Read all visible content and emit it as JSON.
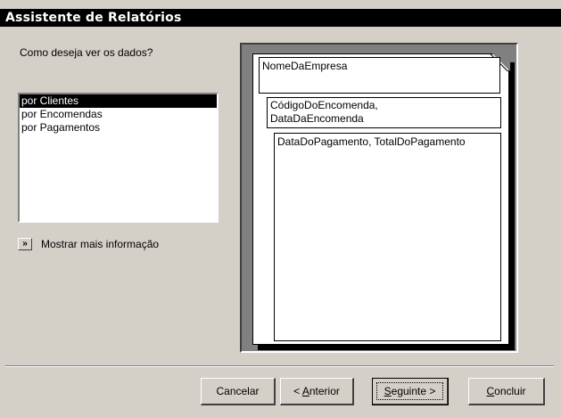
{
  "window": {
    "title": "Assistente de Relatórios"
  },
  "question": "Como deseja ver os dados?",
  "view_list": {
    "items": [
      {
        "label": "por Clientes",
        "selected": true
      },
      {
        "label": "por Encomendas",
        "selected": false
      },
      {
        "label": "por Pagamentos",
        "selected": false
      }
    ]
  },
  "more_info": {
    "button_glyph": "»",
    "label": "Mostrar mais informação"
  },
  "preview": {
    "group1": "NomeDaEmpresa",
    "group2_line1": "CódigoDoEncomenda,",
    "group2_line2": "DataDaEncomenda",
    "detail": "DataDoPagamento, TotalDoPagamento"
  },
  "buttons": {
    "cancel": "Cancelar",
    "back_prefix": "< ",
    "back_mnemonic": "A",
    "back_rest": "nterior",
    "next_mnemonic": "S",
    "next_rest": "eguinte >",
    "finish_mnemonic": "C",
    "finish_rest": "oncluir"
  }
}
